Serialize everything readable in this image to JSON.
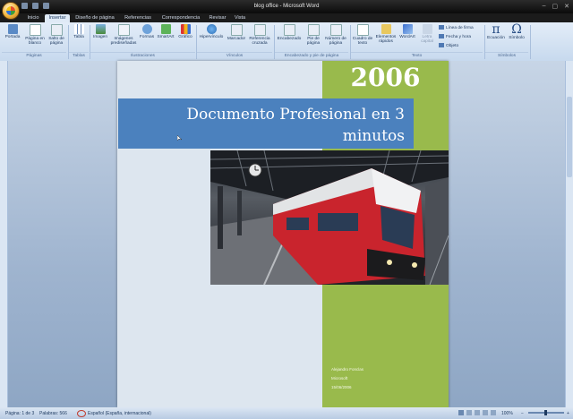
{
  "window": {
    "title": "blog office - Microsoft Word"
  },
  "tabs": [
    "Inicio",
    "Insertar",
    "Diseño de página",
    "Referencias",
    "Correspondencia",
    "Revisar",
    "Vista"
  ],
  "active_tab": "Insertar",
  "ribbon": {
    "groups": [
      {
        "name": "Páginas",
        "buttons": [
          "Portada",
          "Página en blanco",
          "Salto de página"
        ]
      },
      {
        "name": "Tablas",
        "buttons": [
          "Tabla"
        ]
      },
      {
        "name": "Ilustraciones",
        "buttons": [
          "Imagen",
          "Imágenes prediseñadas",
          "Formas",
          "SmartArt",
          "Gráfico"
        ]
      },
      {
        "name": "Vínculos",
        "buttons": [
          "Hipervínculo",
          "Marcador",
          "Referencia cruzada"
        ]
      },
      {
        "name": "Encabezado y pie de página",
        "buttons": [
          "Encabezado",
          "Pie de página",
          "Número de página"
        ]
      },
      {
        "name": "Texto",
        "buttons": [
          "Cuadro de texto",
          "Elementos rápidos",
          "WordArt",
          "Letra capital"
        ],
        "small": [
          "Línea de firma",
          "Fecha y hora",
          "Objeto"
        ]
      },
      {
        "name": "Símbolos",
        "buttons": [
          "Ecuación",
          "Símbolo"
        ]
      }
    ]
  },
  "document": {
    "year": "2006",
    "title": "Documento Profesional en 3 minutos",
    "author": "Alejandro Fonclas",
    "company": "Microsoft",
    "date": "15/06/2006"
  },
  "status": {
    "page": "Página: 1 de 3",
    "words": "Palabras: 566",
    "language": "Español (España, internacional)",
    "zoom": "100%"
  },
  "colors": {
    "title_box": "#4b81be",
    "green_band": "#99ba4c",
    "page_bg": "#dde6ef"
  }
}
